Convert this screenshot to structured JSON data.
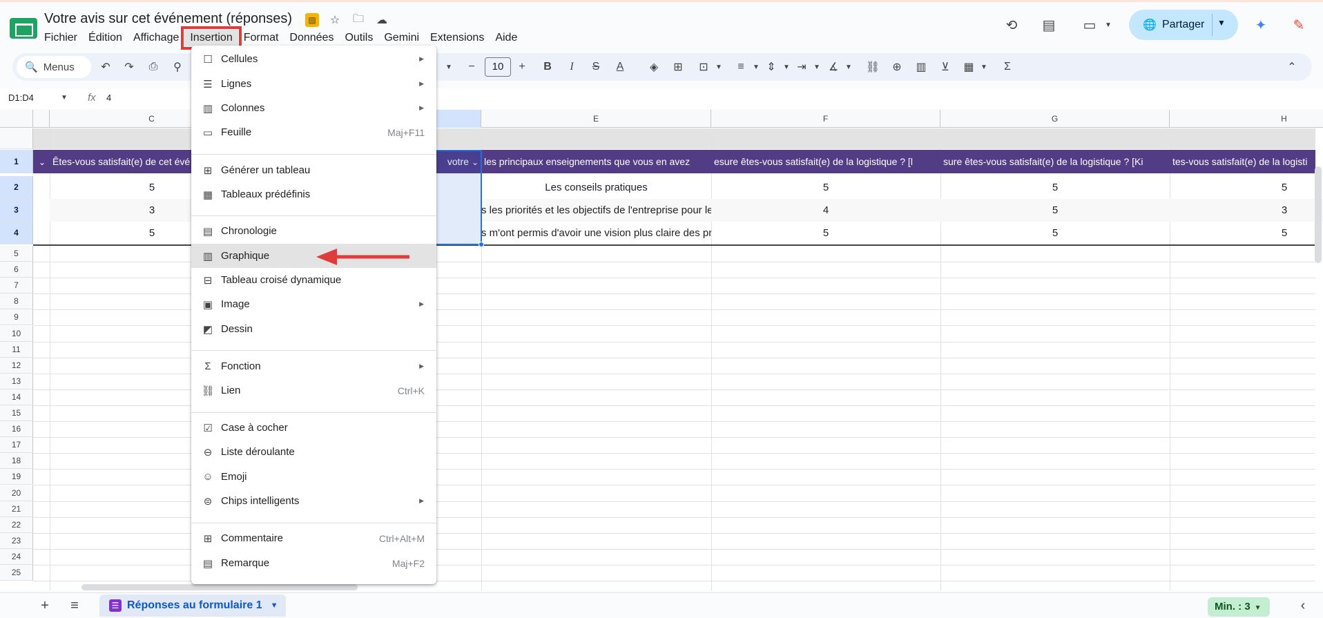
{
  "document": {
    "title": "Votre avis sur cet événement (réponses)",
    "menus": [
      "Fichier",
      "Édition",
      "Affichage",
      "Insertion",
      "Format",
      "Données",
      "Outils",
      "Gemini",
      "Extensions",
      "Aide"
    ],
    "active_menu": "Insertion"
  },
  "header": {
    "share_label": "Partager",
    "icons": [
      "history-icon",
      "comment-icon",
      "meet-icon",
      "gemini-icon",
      "tasks-icon"
    ]
  },
  "toolbar": {
    "search_label": "Menus",
    "font_size": "10"
  },
  "formula_bar": {
    "range": "D1:D4",
    "fx": "fx",
    "value": "4"
  },
  "grid": {
    "columns": [
      "C",
      "E",
      "F",
      "G",
      "H"
    ],
    "rows": [
      "1",
      "2",
      "3",
      "4",
      "5",
      "6",
      "7",
      "8",
      "9",
      "10",
      "11",
      "12",
      "13",
      "14",
      "15",
      "16",
      "17",
      "18",
      "19",
      "20",
      "21",
      "22",
      "23",
      "24",
      "25"
    ],
    "header_cells": {
      "c": "Êtes-vous satisfait(e) de cet évé",
      "d": "votre",
      "e": "les principaux enseignements que vous en avez",
      "f": "esure êtes-vous satisfait(e) de la logistique ? [l",
      "g": "sure êtes-vous satisfait(e) de la logistique ? [Ki",
      "h": "tes-vous satisfait(e) de la logisti",
      "b_chev": "⌄"
    },
    "data": {
      "c": [
        "5",
        "3",
        "5"
      ],
      "e": [
        "Les conseils pratiques",
        "s les priorités et les objectifs de l'entreprise pour le",
        "s m'ont permis d'avoir une vision plus claire des pro"
      ],
      "f": [
        "5",
        "4",
        "5"
      ],
      "g": [
        "5",
        "5",
        "5"
      ],
      "h": [
        "5",
        "3",
        "5"
      ]
    }
  },
  "insert_menu": {
    "items": [
      {
        "label": "Cellules",
        "icon": "checkbox-blank-icon",
        "submenu": true
      },
      {
        "label": "Lignes",
        "icon": "rows-icon",
        "submenu": true
      },
      {
        "label": "Colonnes",
        "icon": "columns-icon",
        "submenu": true
      },
      {
        "label": "Feuille",
        "icon": "sheet-icon",
        "shortcut": "Maj+F11"
      },
      {
        "label": "Générer un tableau",
        "icon": "ai-table-icon"
      },
      {
        "label": "Tableaux prédéfinis",
        "icon": "table-icon"
      },
      {
        "label": "Chronologie",
        "icon": "timeline-icon"
      },
      {
        "label": "Graphique",
        "icon": "chart-icon"
      },
      {
        "label": "Tableau croisé dynamique",
        "icon": "pivot-icon"
      },
      {
        "label": "Image",
        "icon": "image-icon",
        "submenu": true
      },
      {
        "label": "Dessin",
        "icon": "drawing-icon"
      },
      {
        "label": "Fonction",
        "icon": "sigma-icon",
        "submenu": true
      },
      {
        "label": "Lien",
        "icon": "link-icon",
        "shortcut": "Ctrl+K"
      },
      {
        "label": "Case à cocher",
        "icon": "checkbox-icon"
      },
      {
        "label": "Liste déroulante",
        "icon": "dropdown-icon"
      },
      {
        "label": "Emoji",
        "icon": "emoji-icon"
      },
      {
        "label": "Chips intelligents",
        "icon": "smart-chip-icon",
        "submenu": true
      },
      {
        "label": "Commentaire",
        "icon": "comment-add-icon",
        "shortcut": "Ctrl+Alt+M"
      },
      {
        "label": "Remarque",
        "icon": "note-icon",
        "shortcut": "Maj+F2"
      }
    ],
    "highlighted": "Graphique"
  },
  "bottom": {
    "sheet_name": "Réponses au formulaire 1",
    "stat": "Min. : 3"
  },
  "colors": {
    "accent": "#0b57d0",
    "header_fill": "#523c86",
    "annotation_red": "#e13c3c"
  }
}
